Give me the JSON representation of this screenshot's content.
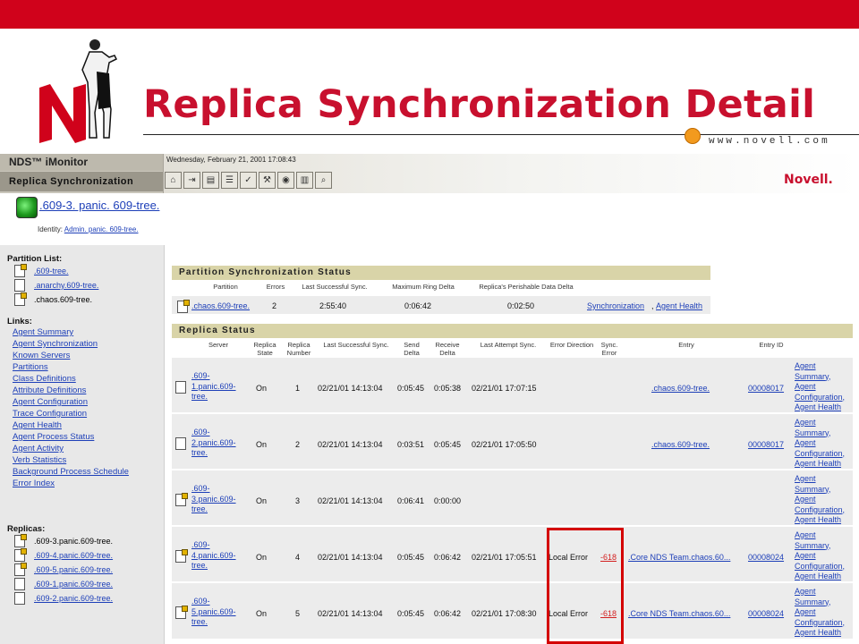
{
  "slide": {
    "title": "Replica Synchronization Detail",
    "url": "www.novell.com"
  },
  "app": {
    "product": "NDS™ iMonitor",
    "page": "Replica Synchronization",
    "datetime": "Wednesday, February 21, 2001 17:08:43",
    "logo": "Novell.",
    "object_name": ".609-3. panic. 609-tree.",
    "identity_label": "Identity:",
    "identity_value": "Admin. panic. 609-tree."
  },
  "toolbar_icons": [
    "home-icon",
    "exit-icon",
    "print-icon",
    "search-icon",
    "check-icon",
    "tools-icon",
    "globe-icon",
    "report-icon",
    "magnify-icon"
  ],
  "partition_list": {
    "heading": "Partition List:",
    "items": [
      ".609-tree.",
      ".anarchy.609-tree.",
      ".chaos.609-tree."
    ]
  },
  "links": {
    "heading": "Links:",
    "items": [
      "Agent Summary",
      "Agent Synchronization",
      "Known Servers",
      "Partitions",
      "Class Definitions",
      "Attribute Definitions",
      "Agent Configuration",
      "Trace Configuration",
      "Agent Health",
      "Agent Process Status",
      "Agent Activity",
      "Verb Statistics",
      "Background Process Schedule",
      "Error Index"
    ]
  },
  "replicas": {
    "heading": "Replicas:",
    "items": [
      ".609-3.panic.609-tree.",
      ".609-4.panic.609-tree.",
      ".609-5.panic.609-tree.",
      ".609-1.panic.609-tree.",
      ".609-2.panic.609-tree."
    ]
  },
  "partition_status": {
    "title": "Partition Synchronization Status",
    "headers": [
      "Partition",
      "Errors",
      "Last Successful Sync.",
      "Maximum Ring Delta",
      "Replica's Perishable Data Delta"
    ],
    "row": {
      "partition": ".chaos.609-tree.",
      "errors": "2",
      "last_sync": "2:55:40",
      "max_ring_delta": "0:06:42",
      "perishable_delta": "0:02:50",
      "link1": "Synchronization",
      "sep": ",",
      "link2": "Agent Health"
    }
  },
  "replica_status": {
    "title": "Replica Status",
    "headers": {
      "server": "Server",
      "state": "Replica State",
      "number": "Replica Number",
      "last_sync": "Last Successful Sync.",
      "send_delta": "Send Delta",
      "receive_delta": "Receive Delta",
      "last_attempt": "Last Attempt Sync.",
      "error_dir": "Error Direction",
      "sync_error": "Sync. Error",
      "entry": "Entry",
      "entry_id": "Entry ID"
    },
    "action_lines": [
      "Agent",
      "Summary,",
      "Agent",
      "Configuration,",
      "Agent Health"
    ],
    "rows": [
      {
        "server": [
          ".609-",
          "1.panic.609-",
          "tree."
        ],
        "state": "On",
        "number": "1",
        "last_sync": "02/21/01 14:13:04",
        "send_delta": "0:05:45",
        "receive_delta": "0:05:38",
        "last_attempt": "02/21/01 17:07:15",
        "error_dir": "",
        "sync_error": "",
        "entry": ".chaos.609-tree.",
        "entry_id": "00008017"
      },
      {
        "server": [
          ".609-",
          "2.panic.609-",
          "tree."
        ],
        "state": "On",
        "number": "2",
        "last_sync": "02/21/01 14:13:04",
        "send_delta": "0:03:51",
        "receive_delta": "0:05:45",
        "last_attempt": "02/21/01 17:05:50",
        "error_dir": "",
        "sync_error": "",
        "entry": ".chaos.609-tree.",
        "entry_id": "00008017"
      },
      {
        "server": [
          ".609-",
          "3.panic.609-",
          "tree."
        ],
        "state": "On",
        "number": "3",
        "last_sync": "02/21/01 14:13:04",
        "send_delta": "0:06:41",
        "receive_delta": "0:00:00",
        "last_attempt": "",
        "error_dir": "",
        "sync_error": "",
        "entry": "",
        "entry_id": ""
      },
      {
        "server": [
          ".609-",
          "4.panic.609-",
          "tree."
        ],
        "state": "On",
        "number": "4",
        "last_sync": "02/21/01 14:13:04",
        "send_delta": "0:05:45",
        "receive_delta": "0:06:42",
        "last_attempt": "02/21/01 17:05:51",
        "error_dir": "Local Error",
        "sync_error": "-618",
        "entry": ".Core NDS Team.chaos.60...",
        "entry_id": "00008024"
      },
      {
        "server": [
          ".609-",
          "5.panic.609-",
          "tree."
        ],
        "state": "On",
        "number": "5",
        "last_sync": "02/21/01 14:13:04",
        "send_delta": "0:05:45",
        "receive_delta": "0:06:42",
        "last_attempt": "02/21/01 17:08:30",
        "error_dir": "Local Error",
        "sync_error": "-618",
        "entry": ".Core NDS Team.chaos.60...",
        "entry_id": "00008024"
      }
    ]
  }
}
